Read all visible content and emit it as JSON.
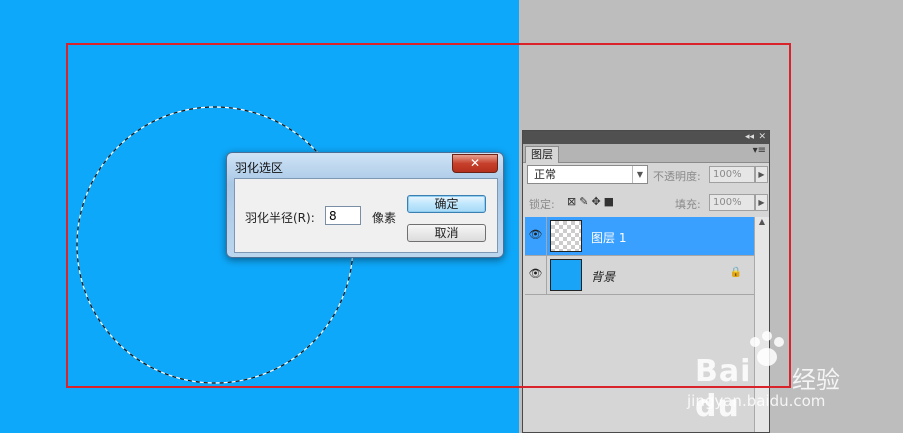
{
  "dialog": {
    "title": "羽化选区",
    "close_glyph": "✕",
    "radius_label": "羽化半径(R):",
    "radius_value": "8",
    "unit": "像素",
    "ok_label": "确定",
    "cancel_label": "取消"
  },
  "layers_panel": {
    "collapse_glyph": "◂◂",
    "close_glyph": "✕",
    "tab_label": "图层",
    "menu_icon": "▾≡",
    "blend_mode": "正常",
    "opacity_label": "不透明度:",
    "opacity_value": "100%",
    "lock_label": "锁定:",
    "fill_label": "填充:",
    "fill_value": "100%",
    "layers": [
      {
        "name": "图层 1",
        "selected": true,
        "thumbnail": "transparent"
      },
      {
        "name": "背景",
        "selected": false,
        "thumbnail": "blue",
        "locked": true
      }
    ]
  },
  "watermark": {
    "brand": "Bai du",
    "brand_cn": "经验",
    "url": "jingyan.baidu.com"
  },
  "colors": {
    "canvas_blue": "#0ea8fa",
    "workspace_gray": "#bdbdbd",
    "frame_red": "#d9232b",
    "selected_layer": "#3aa0ff"
  }
}
